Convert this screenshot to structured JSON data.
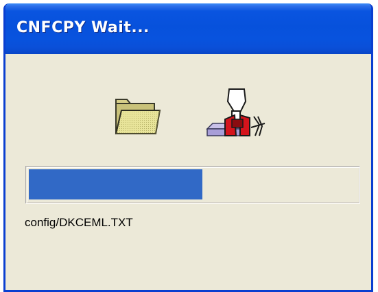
{
  "window": {
    "title": "CNFCPY Wait..."
  },
  "icons": {
    "source": "folder-icon",
    "destination": "device-icon"
  },
  "progress": {
    "fraction": 0.53,
    "color": "#3169c6"
  },
  "status": {
    "current_file": "config/DKCEML.TXT"
  },
  "colors": {
    "title_bar": "#0751dc",
    "window_face": "#ece9d8",
    "frame_border": "#0a3fd0"
  }
}
